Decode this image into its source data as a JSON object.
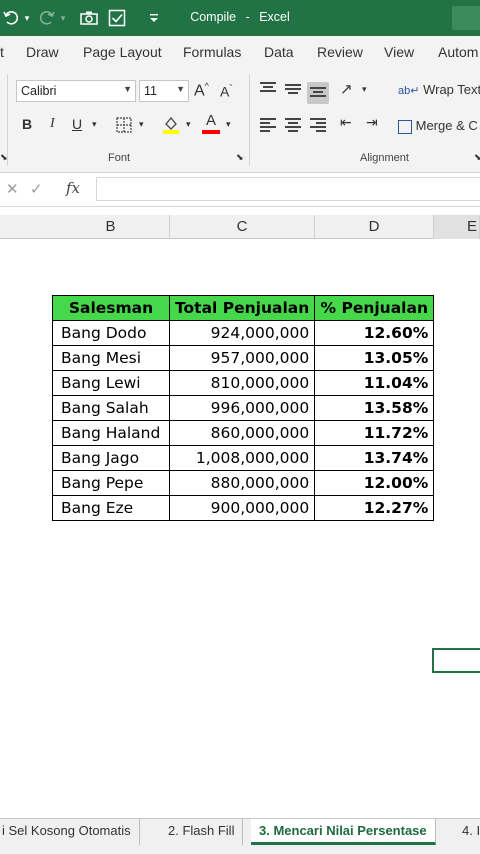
{
  "titlebar": {
    "document": "Compile",
    "separator": "-",
    "app": "Excel",
    "undo_icon": "undo-icon",
    "redo_icon": "redo-icon",
    "camera_icon": "camera-icon",
    "checkbox_icon": "checkbox-icon",
    "customize_icon": "customize-quick-access-icon"
  },
  "ribbon_tabs": [
    "t",
    "Draw",
    "Page Layout",
    "Formulas",
    "Data",
    "Review",
    "View",
    "Autom"
  ],
  "font_group": {
    "font_name": "Calibri",
    "font_size": "11",
    "grow_label": "A",
    "shrink_label": "A",
    "bold": "B",
    "italic": "I",
    "underline": "U",
    "font_color_label": "A",
    "label": "Font",
    "highlight_color": "#ffff00",
    "font_color": "#ff0000"
  },
  "alignment_group": {
    "wrap_text": "Wrap Text",
    "merge_center": "Merge & C",
    "label": "Alignment"
  },
  "formula_bar": {
    "cancel": "✕",
    "enter": "✓",
    "fx": "fx",
    "value": ""
  },
  "columns": [
    "B",
    "C",
    "D",
    "E"
  ],
  "table": {
    "headers": [
      "Salesman",
      "Total Penjualan",
      "% Penjualan"
    ],
    "rows": [
      [
        "Bang Dodo",
        "924,000,000",
        "12.60%"
      ],
      [
        "Bang Mesi",
        "957,000,000",
        "13.05%"
      ],
      [
        "Bang Lewi",
        "810,000,000",
        "11.04%"
      ],
      [
        "Bang Salah",
        "996,000,000",
        "13.58%"
      ],
      [
        "Bang Haland",
        "860,000,000",
        "11.72%"
      ],
      [
        "Bang Jago",
        "1,008,000,000",
        "13.74%"
      ],
      [
        "Bang Pepe",
        "880,000,000",
        "12.00%"
      ],
      [
        "Bang Eze",
        "900,000,000",
        "12.27%"
      ]
    ]
  },
  "sheet_tabs": [
    {
      "label": "i Sel Kosong Otomatis",
      "active": false
    },
    {
      "label": "2. Flash Fill",
      "active": false
    },
    {
      "label": "3. Mencari Nilai Persentase",
      "active": true
    },
    {
      "label": "4. I",
      "active": false
    }
  ],
  "colors": {
    "excel_green": "#217346",
    "header_fill": "#47d74a"
  }
}
